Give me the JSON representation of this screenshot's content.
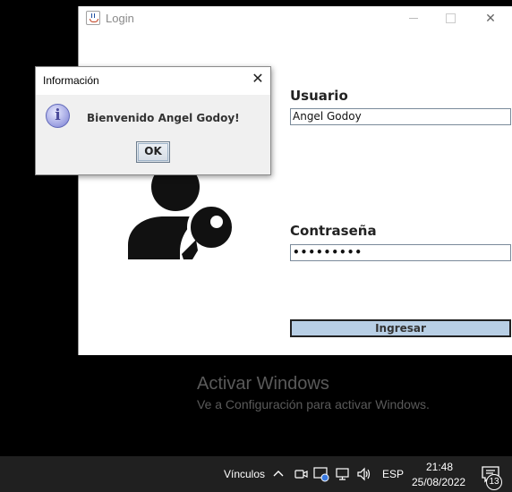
{
  "login_window": {
    "title": "Login",
    "minimize_icon": "minimize-icon",
    "maximize_icon": "maximize-icon",
    "close_glyph": "✕",
    "user_label": "Usuario",
    "user_value": "Angel Godoy",
    "password_label": "Contraseña",
    "password_value": "•••••••••",
    "submit_label": "Ingresar",
    "illustration_icon": "user-key-icon"
  },
  "dialog": {
    "title": "Información",
    "close_glyph": "✕",
    "icon_glyph": "i",
    "message": "Bienvenido Angel Godoy!",
    "ok_label": "OK"
  },
  "watermark": {
    "title": "Activar Windows",
    "subtitle": "Ve a Configuración para activar Windows."
  },
  "taskbar": {
    "links_label": "Vínculos",
    "language": "ESP",
    "time": "21:48",
    "date": "25/08/2022",
    "notification_count": "13",
    "tray_icons": [
      "chevron-up-icon",
      "meet-now-icon",
      "security-icon",
      "network-icon",
      "volume-icon",
      "notification-icon"
    ]
  },
  "colors": {
    "button_fill": "#b8cfe5",
    "desktop": "#000000",
    "taskbar": "#202020"
  }
}
